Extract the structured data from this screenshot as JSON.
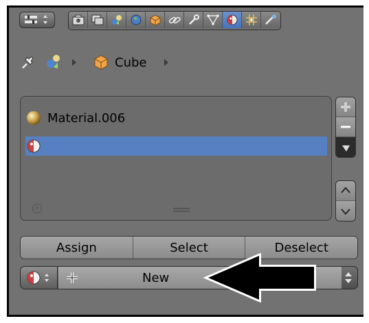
{
  "header": {
    "editor_type_icon": "properties-editor-icon",
    "context_tabs": [
      {
        "name": "render-icon",
        "active": false
      },
      {
        "name": "render-layers-icon",
        "active": false
      },
      {
        "name": "scene-icon",
        "active": false
      },
      {
        "name": "world-icon",
        "active": false
      },
      {
        "name": "object-icon",
        "active": false
      },
      {
        "name": "constraints-icon",
        "active": false
      },
      {
        "name": "modifiers-icon",
        "active": false
      },
      {
        "name": "object-data-icon",
        "active": false
      },
      {
        "name": "material-icon",
        "active": true
      },
      {
        "name": "texture-icon",
        "active": false
      },
      {
        "name": "physics-icon",
        "active": false
      }
    ]
  },
  "breadcrumb": {
    "pin_icon": "pin-icon",
    "scene_icon": "scene-icon",
    "object_label": "Cube"
  },
  "material_slots": {
    "items": [
      {
        "label": "Material.006",
        "icon": "material-sphere-icon",
        "selected": false
      },
      {
        "label": "",
        "icon": "empty-material-icon",
        "selected": true
      }
    ]
  },
  "side_buttons": {
    "add": "+",
    "remove": "−",
    "specials": "specials-menu-icon",
    "move_up": "move-up-icon",
    "move_down": "move-down-icon"
  },
  "actions": {
    "assign": "Assign",
    "select": "Select",
    "deselect": "Deselect"
  },
  "material_datablock": {
    "new_label": "New",
    "browse_icon": "material-browse-icon",
    "add_icon": "plus-icon"
  },
  "colors": {
    "panel_bg": "#727272",
    "selection": "#5680c2",
    "active_tab": "#5680c2"
  }
}
